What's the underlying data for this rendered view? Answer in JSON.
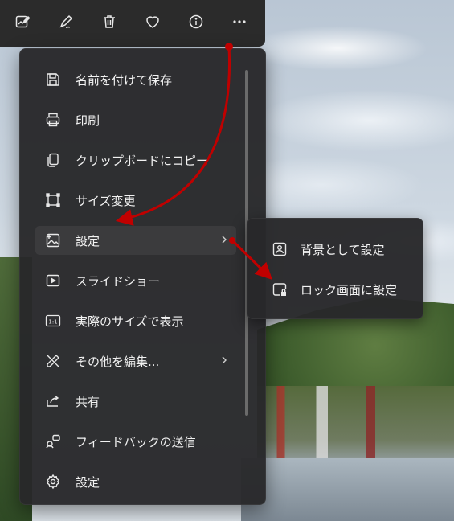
{
  "toolbar": {
    "buttons": [
      {
        "icon": "edit-image-icon"
      },
      {
        "icon": "draw-icon"
      },
      {
        "icon": "delete-icon"
      },
      {
        "icon": "favorite-icon"
      },
      {
        "icon": "info-icon"
      },
      {
        "icon": "more-options-icon"
      }
    ]
  },
  "menu": {
    "items": [
      {
        "label": "名前を付けて保存",
        "icon": "save-icon"
      },
      {
        "label": "印刷",
        "icon": "print-icon"
      },
      {
        "label": "クリップボードにコピー",
        "icon": "copy-icon"
      },
      {
        "label": "サイズ変更",
        "icon": "resize-icon"
      },
      {
        "label": "設定",
        "icon": "set-as-icon",
        "has_submenu": true,
        "selected": true
      },
      {
        "label": "スライドショー",
        "icon": "slideshow-icon"
      },
      {
        "label": "実際のサイズで表示",
        "icon": "actual-size-icon"
      },
      {
        "label": "その他を編集...",
        "icon": "edit-more-icon",
        "has_submenu": true
      },
      {
        "label": "共有",
        "icon": "share-icon"
      },
      {
        "label": "フィードバックの送信",
        "icon": "feedback-icon"
      },
      {
        "label": "設定",
        "icon": "settings-icon"
      }
    ]
  },
  "submenu": {
    "items": [
      {
        "label": "背景として設定",
        "icon": "set-as-background-icon"
      },
      {
        "label": "ロック画面に設定",
        "icon": "set-as-lock-screen-icon"
      }
    ]
  },
  "colors": {
    "menu_bg": "#282828",
    "text": "#f2f2f2",
    "annotation_arrow": "#c00000"
  }
}
